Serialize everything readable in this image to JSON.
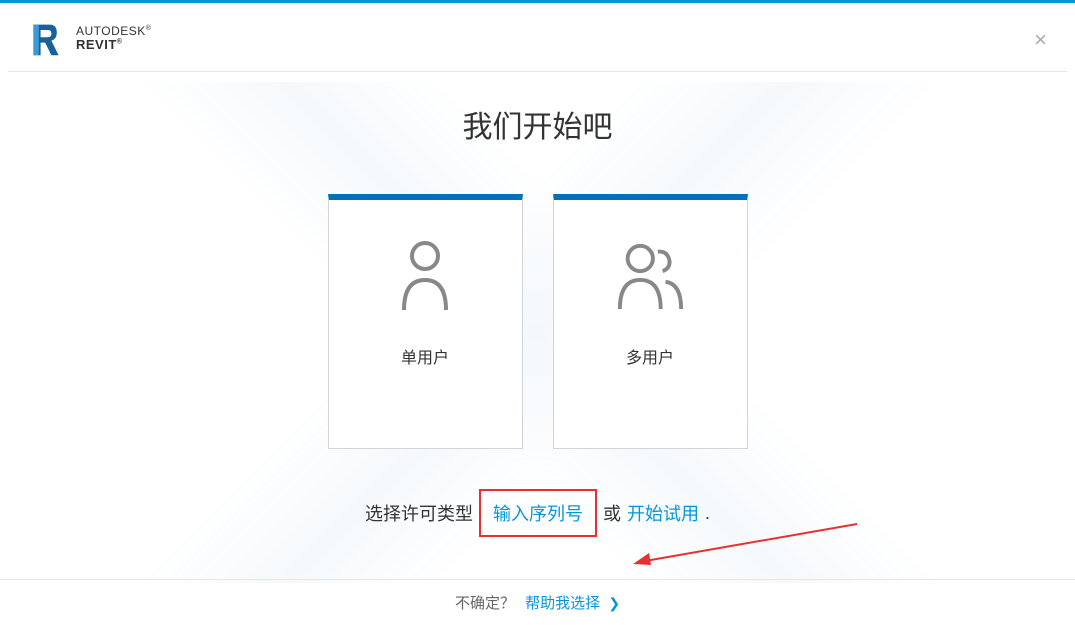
{
  "brand": {
    "line1": "AUTODESK",
    "line2": "REVIT"
  },
  "main": {
    "title": "我们开始吧"
  },
  "cards": {
    "single": "单用户",
    "multi": "多用户"
  },
  "license": {
    "prefix": "选择许可类型",
    "enter_serial": "输入序列号",
    "or": "或",
    "start_trial": "开始试用",
    "period": "."
  },
  "footer": {
    "unsure": "不确定？",
    "help_choose": "帮助我选择"
  }
}
